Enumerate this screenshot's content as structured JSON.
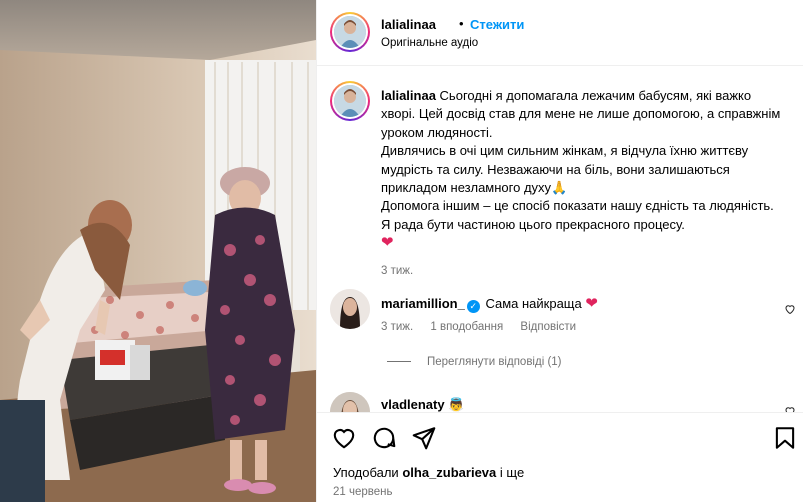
{
  "post": {
    "username": "lalialinaa",
    "dot": "•",
    "follow_label": "Стежити",
    "audio": "Оригінальне аудіо"
  },
  "caption": {
    "username": "lalialinaa",
    "line1": "Сьогодні я допомагала лежачим бабусям, які важко хворі. Цей досвід став для мене не лише допомогою, а справжнім уроком людяності.",
    "line2": "Дивлячись в очі цим сильним жінкам, я відчула їхню життєву мудрість та силу. Незважаючи на біль, вони залишаються прикладом незламного духу🙏",
    "line3": "Допомога іншим – це спосіб показати нашу єдність та людяність. Я рада бути частиною цього прекрасного процесу.",
    "heart": "❤",
    "time": "3 тиж."
  },
  "comments": [
    {
      "username": "mariamillion_",
      "verified_mark": "✓",
      "text": "Сама найкраща",
      "emoji": "❤",
      "time": "3 тиж.",
      "likes": "1 вподобання",
      "reply_label": "Відповісти",
      "view_replies": "Переглянути відповіді (1)"
    },
    {
      "username": "vladlenaty",
      "emoji": "👼"
    }
  ],
  "footer": {
    "liked_prefix": "Уподобали",
    "liked_user": "olha_zubarieva",
    "liked_suffix": "і ще",
    "date": "21 червень"
  },
  "colors": {
    "accent": "#0095f6",
    "muted": "#737373",
    "heart": "#e0245e"
  },
  "icons": [
    "heart-icon",
    "comment-icon",
    "share-icon",
    "bookmark-icon"
  ]
}
